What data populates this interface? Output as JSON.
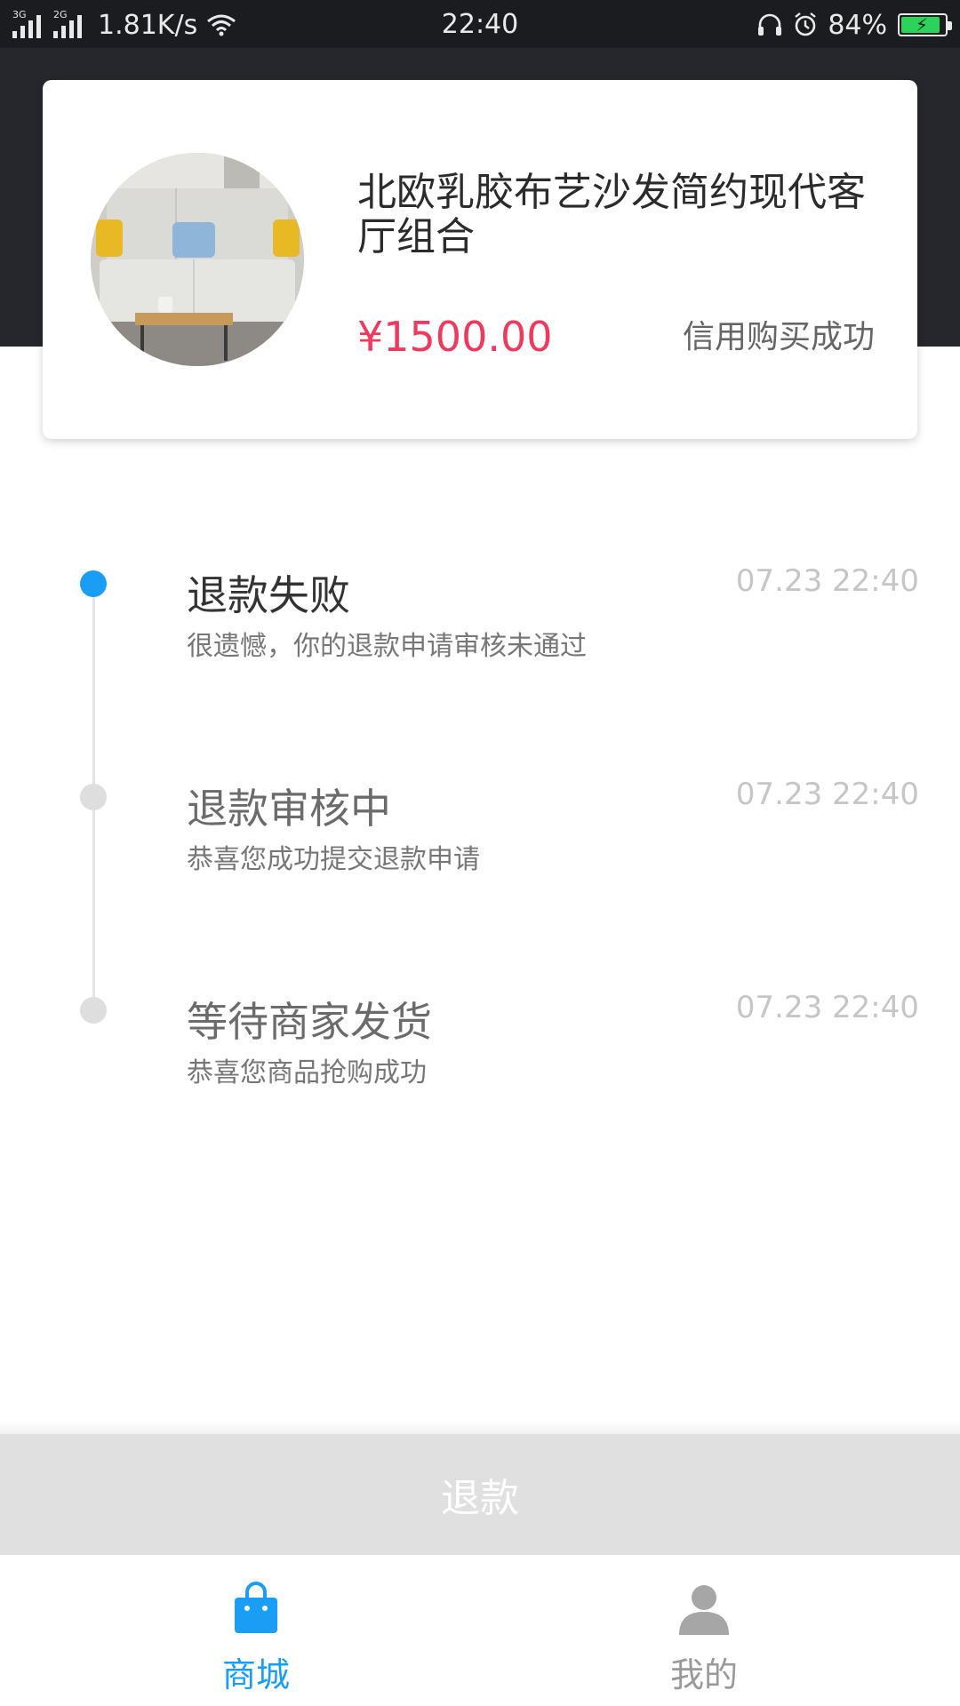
{
  "status_bar": {
    "signal1_gen": "3G",
    "signal2_gen": "2G",
    "net_speed": "1.81K/s",
    "time": "22:40",
    "battery_pct": "84%",
    "battery_level": 0.84,
    "icons": [
      "signal-icon",
      "wifi-icon",
      "headset-icon",
      "alarm-icon",
      "battery-charging-icon"
    ]
  },
  "product": {
    "title": "北欧乳胶布艺沙发简约现代客厅组合",
    "price": "¥1500.00",
    "status": "信用购买成功",
    "image_icon": "sofa-image"
  },
  "timeline": [
    {
      "title": "退款失败",
      "desc": "很遗憾，你的退款申请审核未通过",
      "time": "07.23 22:40",
      "active": true
    },
    {
      "title": "退款审核中",
      "desc": "恭喜您成功提交退款申请",
      "time": "07.23 22:40",
      "active": false
    },
    {
      "title": "等待商家发货",
      "desc": "恭喜您商品抢购成功",
      "time": "07.23 22:40",
      "active": false
    }
  ],
  "refund_button": {
    "label": "退款"
  },
  "tabs": [
    {
      "label": "商城",
      "icon": "shopping-bag-icon",
      "active": true
    },
    {
      "label": "我的",
      "icon": "user-icon",
      "active": false
    }
  ],
  "colors": {
    "accent": "#1a9ef5",
    "price": "#ef3a5d",
    "header": "#26272c",
    "status_bar": "#1b1c20"
  }
}
